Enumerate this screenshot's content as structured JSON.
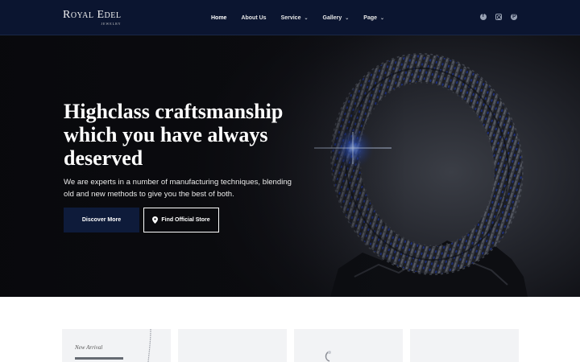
{
  "brand": {
    "name": "Royal Edel",
    "tagline": "JEWELRY"
  },
  "nav": {
    "items": [
      {
        "label": "Home",
        "dropdown": false,
        "active": true
      },
      {
        "label": "About Us",
        "dropdown": false,
        "active": false
      },
      {
        "label": "Service",
        "dropdown": true,
        "active": false
      },
      {
        "label": "Gallery",
        "dropdown": true,
        "active": false
      },
      {
        "label": "Page",
        "dropdown": true,
        "active": false
      }
    ],
    "socials": [
      "facebook-icon",
      "instagram-icon",
      "pinterest-icon"
    ]
  },
  "hero": {
    "title": "Highclass craftsmanship which you have always deserved",
    "description": "We are experts in a number of manufacturing techniques, blending old and new methods to give you the best of both.",
    "primary_button": "Discover More",
    "secondary_button": "Find Official Store"
  },
  "cards": [
    {
      "tag": "New Arrival"
    },
    {
      "tag": ""
    },
    {
      "tag": ""
    },
    {
      "tag": ""
    }
  ],
  "colors": {
    "nav_bg": "#0b1530",
    "primary_button": "#0e1b3a",
    "card_bg": "#f2f3f5"
  }
}
